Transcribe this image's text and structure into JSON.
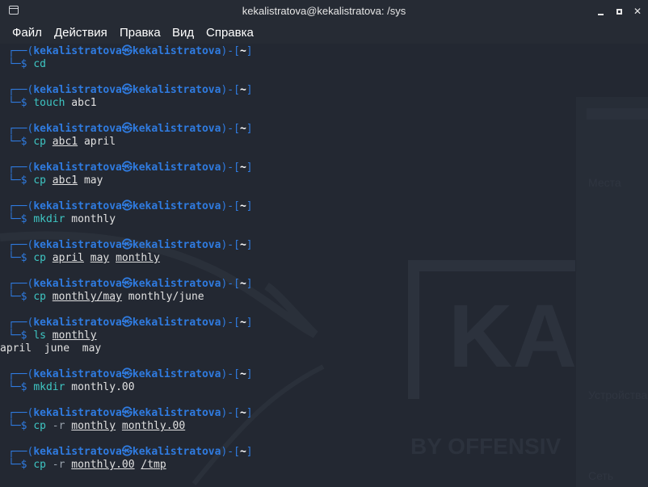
{
  "window": {
    "title": "kekalistratova@kekalistratova: /sys"
  },
  "menu": [
    "Файл",
    "Действия",
    "Правка",
    "Вид",
    "Справка"
  ],
  "prompt": {
    "user": "kekalistratova",
    "at": "㉿",
    "host": "kekalistratova",
    "dir": "~",
    "top_prefix": "┌──(",
    "mid": ")-[",
    "end": "]",
    "bottom_prefix": "└─$ "
  },
  "entries": [
    {
      "cmd": "cd",
      "args": []
    },
    {
      "cmd": "touch",
      "args": [
        {
          "t": "abc1",
          "u": false
        }
      ]
    },
    {
      "cmd": "cp",
      "args": [
        {
          "t": "abc1",
          "u": true
        },
        {
          "t": "april",
          "u": false
        }
      ]
    },
    {
      "cmd": "cp",
      "args": [
        {
          "t": "abc1",
          "u": true
        },
        {
          "t": "may",
          "u": false
        }
      ]
    },
    {
      "cmd": "mkdir",
      "args": [
        {
          "t": "monthly",
          "u": false
        }
      ]
    },
    {
      "cmd": "cp",
      "args": [
        {
          "t": "april",
          "u": true
        },
        {
          "t": "may",
          "u": true
        },
        {
          "t": "monthly",
          "u": true
        }
      ]
    },
    {
      "cmd": "cp",
      "args": [
        {
          "t": "monthly/may",
          "u": true
        },
        {
          "t": "monthly/june",
          "u": false
        }
      ]
    },
    {
      "cmd": "ls",
      "args": [
        {
          "t": "monthly",
          "u": true
        }
      ],
      "output": "april  june  may"
    },
    {
      "cmd": "mkdir",
      "args": [
        {
          "t": "monthly.00",
          "u": false
        }
      ]
    },
    {
      "cmd": "cp",
      "args": [
        {
          "t": "-r",
          "flag": true
        },
        {
          "t": "monthly",
          "u": true
        },
        {
          "t": "monthly.00",
          "u": true
        }
      ]
    },
    {
      "cmd": "cp",
      "args": [
        {
          "t": "-r",
          "flag": true
        },
        {
          "t": "monthly.00",
          "u": true
        },
        {
          "t": "/tmp",
          "u": true
        }
      ]
    }
  ],
  "background": {
    "wallpaper_text": [
      "KA",
      "BY OFFENSIV"
    ],
    "ghost_sidebar": [
      "Места",
      "Устройства",
      "Сеть"
    ]
  },
  "colors": {
    "prompt_blue": "#2f7be0",
    "command_cyan": "#3ec6c3",
    "terminal_bg": "#232832"
  }
}
